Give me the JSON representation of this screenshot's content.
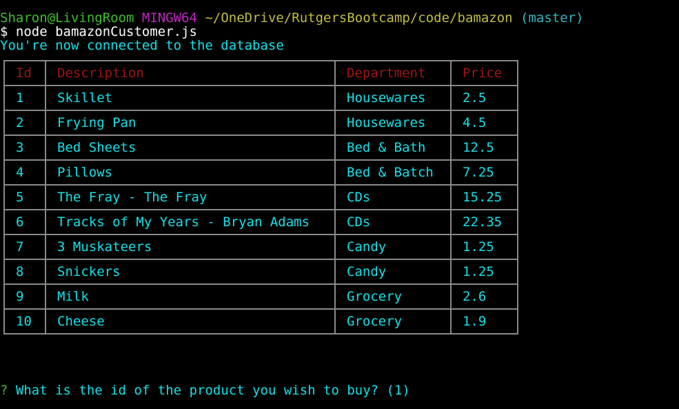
{
  "terminal": {
    "prompt": {
      "user_host": "Sharon@LivingRoom",
      "system": "MINGW64",
      "path": "~/OneDrive/RutgersBootcamp/code/bamazon",
      "branch": "(master)"
    },
    "command": "$ node bamazonCustomer.js",
    "status_message": "You're now connected to the database",
    "table": {
      "headers": [
        "Id",
        "Description",
        "Department",
        "Price"
      ],
      "rows": [
        [
          "1",
          "Skillet",
          "Housewares",
          "2.5"
        ],
        [
          "2",
          "Frying Pan",
          "Housewares",
          "4.5"
        ],
        [
          "3",
          "Bed Sheets",
          "Bed & Bath",
          "12.5"
        ],
        [
          "4",
          "Pillows",
          "Bed & Batch",
          "7.25"
        ],
        [
          "5",
          "The Fray - The Fray",
          "CDs",
          "15.25"
        ],
        [
          "6",
          "Tracks of My Years - Bryan Adams",
          "CDs",
          "22.35"
        ],
        [
          "7",
          "3 Muskateers",
          "Candy",
          "1.25"
        ],
        [
          "8",
          "Snickers",
          "Candy",
          "1.25"
        ],
        [
          "9",
          "Milk",
          "Grocery",
          "2.6"
        ],
        [
          "10",
          "Cheese",
          "Grocery",
          "1.9"
        ]
      ]
    },
    "question": {
      "marker": "?",
      "text": "What is the id of the product you wish to buy? (1)"
    },
    "colors": {
      "background": "#000000",
      "user_host": "#3fbf2a",
      "system": "#c026c0",
      "path": "#c2bf3a",
      "branch": "#2fb8c0",
      "table_header": "#a01414",
      "table_cell": "#15e0e8",
      "table_border": "#8a8a8a",
      "output_text": "#15e0e8",
      "question_marker": "#3fbf2a"
    }
  }
}
